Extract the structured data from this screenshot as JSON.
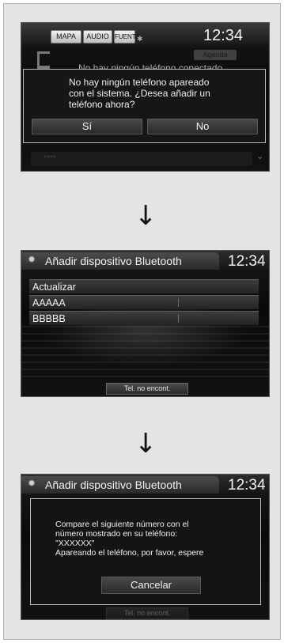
{
  "screen1": {
    "tabs": [
      "MAPA",
      "AUDIO",
      "FUENTE"
    ],
    "clock": "12:34",
    "agenda_label": "Agenda",
    "background_status": "No hay ningún teléfono conectado",
    "dialog_lines": [
      "No hay ningún teléfono apareado",
      "con el sistema. ¿Desea añadir un",
      "teléfono ahora?"
    ],
    "yes_label": "Sí",
    "no_label": "No",
    "bottom_item": "****"
  },
  "screen2": {
    "title": "Añadir dispositivo Bluetooth",
    "clock": "12:34",
    "items": [
      "Actualizar",
      "AAAAA",
      "BBBBB"
    ],
    "footer_label": "Tel. no encont."
  },
  "screen3": {
    "title": "Añadir dispositivo Bluetooth",
    "clock": "12:34",
    "dialog_lines": [
      "Compare el siguiente número con el",
      "número mostrado en su teléfono:",
      "\"XXXXXX\"",
      "Apareando el teléfono, por favor, espere"
    ],
    "cancel_label": "Cancelar",
    "footer_label": "Tel. no encont."
  },
  "arrows": [
    "↓",
    "↓"
  ]
}
